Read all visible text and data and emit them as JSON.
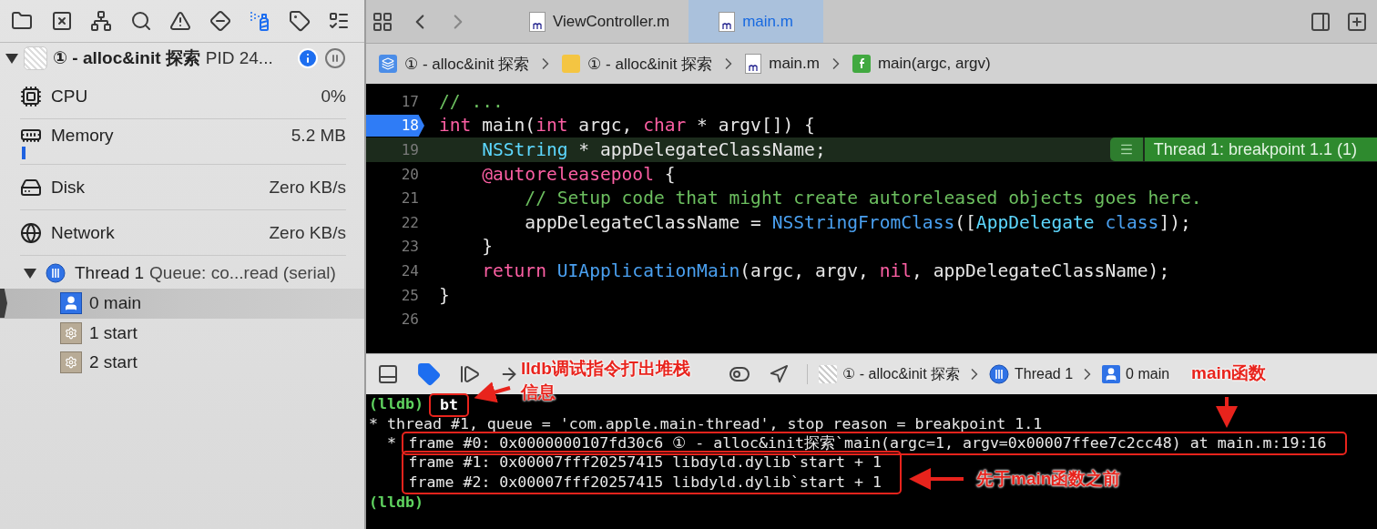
{
  "navigator": {
    "process": {
      "title": "① - alloc&init 探索",
      "pid": "PID 24..."
    },
    "gauges": [
      {
        "kind": "cpu",
        "name": "CPU",
        "value": "0%"
      },
      {
        "kind": "memory",
        "name": "Memory",
        "value": "5.2 MB",
        "level": 0.01
      },
      {
        "kind": "disk",
        "name": "Disk",
        "value": "Zero KB/s"
      },
      {
        "kind": "network",
        "name": "Network",
        "value": "Zero KB/s"
      }
    ],
    "thread": {
      "name": "Thread 1",
      "queue": "Queue: co...read (serial)",
      "expanded": true
    },
    "frames": [
      {
        "kind": "user",
        "label": "0 main",
        "selected": true
      },
      {
        "kind": "system",
        "label": "1 start",
        "selected": false
      },
      {
        "kind": "system",
        "label": "2 start",
        "selected": false
      }
    ]
  },
  "tabs": [
    {
      "label": "ViewController.m",
      "selected": false
    },
    {
      "label": "main.m",
      "selected": true
    }
  ],
  "breadcrumb": [
    {
      "kind": "app",
      "label": "① - alloc&init 探索"
    },
    {
      "kind": "folder",
      "label": "① - alloc&init 探索"
    },
    {
      "kind": "file",
      "label": "main.m"
    },
    {
      "kind": "function",
      "label": "main(argc, argv)"
    }
  ],
  "code": {
    "badge": "Thread 1: breakpoint 1.1 (1)",
    "lines": [
      {
        "number": "17",
        "breakpoint": false,
        "current": false,
        "tokens": [
          {
            "kind": "comment",
            "text": "// ..."
          }
        ]
      },
      {
        "number": "18",
        "breakpoint": true,
        "current": false,
        "tokens": [
          {
            "kind": "keyword",
            "text": "int"
          },
          {
            "kind": "plain",
            "text": " main("
          },
          {
            "kind": "keyword",
            "text": "int"
          },
          {
            "kind": "plain",
            "text": " argc, "
          },
          {
            "kind": "keyword",
            "text": "char"
          },
          {
            "kind": "plain",
            "text": " * argv[]) {"
          }
        ]
      },
      {
        "number": "19",
        "breakpoint": false,
        "current": true,
        "tokens": [
          {
            "kind": "type",
            "text": "    NSString"
          },
          {
            "kind": "plain",
            "text": " * appDelegateClassName;"
          }
        ]
      },
      {
        "number": "20",
        "breakpoint": false,
        "current": false,
        "tokens": [
          {
            "kind": "keyword",
            "text": "    @autoreleasepool"
          },
          {
            "kind": "plain",
            "text": " {"
          }
        ]
      },
      {
        "number": "21",
        "breakpoint": false,
        "current": false,
        "tokens": [
          {
            "kind": "comment",
            "text": "        // Setup code that might create autoreleased objects goes here."
          }
        ]
      },
      {
        "number": "22",
        "breakpoint": false,
        "current": false,
        "tokens": [
          {
            "kind": "plain",
            "text": "        appDelegateClassName = "
          },
          {
            "kind": "function",
            "text": "NSStringFromClass"
          },
          {
            "kind": "plain",
            "text": "(["
          },
          {
            "kind": "type",
            "text": "AppDelegate"
          },
          {
            "kind": "function",
            "text": " class"
          },
          {
            "kind": "plain",
            "text": "]);"
          }
        ]
      },
      {
        "number": "23",
        "breakpoint": false,
        "current": false,
        "tokens": [
          {
            "kind": "plain",
            "text": "    }"
          }
        ]
      },
      {
        "number": "24",
        "breakpoint": false,
        "current": false,
        "tokens": [
          {
            "kind": "keyword",
            "text": "    return"
          },
          {
            "kind": "function",
            "text": " UIApplicationMain"
          },
          {
            "kind": "plain",
            "text": "(argc, argv, "
          },
          {
            "kind": "keyword",
            "text": "nil"
          },
          {
            "kind": "plain",
            "text": ", appDelegateClassName);"
          }
        ]
      },
      {
        "number": "25",
        "breakpoint": false,
        "current": false,
        "tokens": [
          {
            "kind": "plain",
            "text": "}"
          }
        ]
      },
      {
        "number": "26",
        "breakpoint": false,
        "current": false
      }
    ]
  },
  "debug_bar": {
    "breakpoints_active": true,
    "path": [
      {
        "kind": "app",
        "label": "① - alloc&init 探索"
      },
      {
        "kind": "thread",
        "label": "Thread 1"
      },
      {
        "kind": "frame",
        "label": "0 main"
      }
    ]
  },
  "console": [
    {
      "kind": "prompt",
      "prompt": "(lldb)",
      "text": "bt",
      "boxed": true
    },
    {
      "kind": "output",
      "text": "* thread #1, queue = 'com.apple.main-thread', stop reason = breakpoint 1.1"
    },
    {
      "kind": "frame",
      "boxed": true,
      "marker": "*",
      "text": "frame #0: 0x0000000107fd30c6 ① - alloc&init探索`main(argc=1, argv=0x00007ffee7c2cc48) at main.m:19:16"
    },
    {
      "kind": "frame",
      "boxed": true,
      "text": "frame #1: 0x00007fff20257415 libdyld.dylib`start + 1"
    },
    {
      "kind": "frame",
      "boxed": true,
      "text": "frame #2: 0x00007fff20257415 libdyld.dylib`start + 1"
    },
    {
      "kind": "prompt",
      "prompt": "(lldb)"
    }
  ],
  "annotations": [
    {
      "text": "lldb调试指令打出堆栈信息"
    },
    {
      "text": "main函数"
    },
    {
      "text": "先于main函数之前"
    }
  ]
}
